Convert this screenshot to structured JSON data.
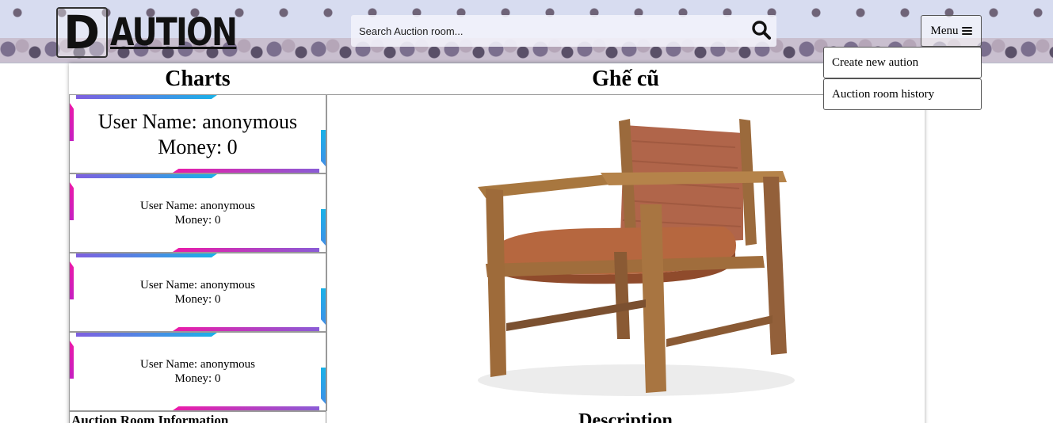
{
  "header": {
    "logo_letter": "D",
    "logo_text": "AUTION",
    "search": {
      "placeholder": "Search Auction room..."
    },
    "menu_label": "Menu",
    "menu_items": [
      "Create new aution",
      "Auction room history"
    ]
  },
  "charts": {
    "title": "Charts",
    "entries": [
      {
        "name": "User Name: anonymous",
        "money": "Money: 0"
      },
      {
        "name": "User Name: anonymous",
        "money": "Money: 0"
      },
      {
        "name": "User Name: anonymous",
        "money": "Money: 0"
      },
      {
        "name": "User Name: anonymous",
        "money": "Money: 0"
      }
    ]
  },
  "room_info_title": "Auction Room Information",
  "item": {
    "title": "Ghế cũ",
    "description_heading": "Description"
  },
  "colors": {
    "header_bg": "#d7dcf0",
    "strip_blue": "#19b2e8",
    "strip_pink": "#ec1aa8",
    "strip_purple": "#7f5fe0"
  },
  "icons": {
    "search": "search-icon",
    "menu": "bars-icon"
  }
}
